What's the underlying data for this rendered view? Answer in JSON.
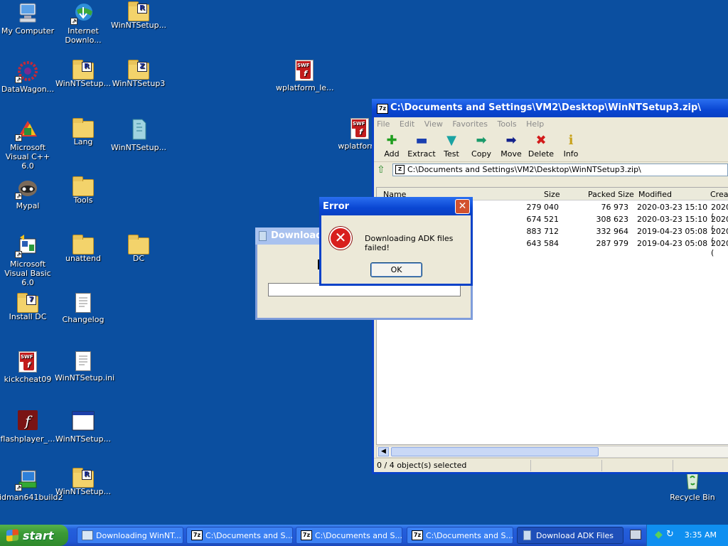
{
  "desktop": {
    "icons": [
      {
        "label": "My Computer"
      },
      {
        "label": "Internet Downlo..."
      },
      {
        "label": "WinNTSetup..."
      },
      {
        "label": "DataWagon..."
      },
      {
        "label": "WinNTSetup..."
      },
      {
        "label": "WinNTSetup3"
      },
      {
        "label": "wplatform_le..."
      },
      {
        "label": "Microsoft Visual C++ 6.0"
      },
      {
        "label": "Lang"
      },
      {
        "label": "WinNTSetup..."
      },
      {
        "label": "wplatform_"
      },
      {
        "label": "Mypal"
      },
      {
        "label": "Tools"
      },
      {
        "label": "Microsoft Visual Basic 6.0"
      },
      {
        "label": "unattend"
      },
      {
        "label": "DC"
      },
      {
        "label": "Install DC"
      },
      {
        "label": "Changelog"
      },
      {
        "label": "kickcheat09"
      },
      {
        "label": "WinNTSetup.ini"
      },
      {
        "label": "flashplayer_..."
      },
      {
        "label": "WinNTSetup..."
      },
      {
        "label": "idman641build2"
      },
      {
        "label": "WinNTSetup..."
      },
      {
        "label": "Recycle Bin"
      }
    ]
  },
  "zip_window": {
    "title": "C:\\Documents and Settings\\VM2\\Desktop\\WinNTSetup3.zip\\",
    "menu": [
      "File",
      "Edit",
      "View",
      "Favorites",
      "Tools",
      "Help"
    ],
    "toolbar": [
      {
        "label": "Add",
        "icon": "plus-icon",
        "color": "#1f9e1f"
      },
      {
        "label": "Extract",
        "icon": "minus-icon",
        "color": "#1a3fb0"
      },
      {
        "label": "Test",
        "icon": "check-arrow-icon",
        "color": "#1aa3a3"
      },
      {
        "label": "Copy",
        "icon": "copy-arrow-icon",
        "color": "#1a9a6a"
      },
      {
        "label": "Move",
        "icon": "move-arrow-icon",
        "color": "#14228c"
      },
      {
        "label": "Delete",
        "icon": "delete-x-icon",
        "color": "#d21a1a"
      },
      {
        "label": "Info",
        "icon": "info-icon",
        "color": "#c9a21a"
      }
    ],
    "address": "C:\\Documents and Settings\\VM2\\Desktop\\WinNTSetup3.zip\\",
    "columns": [
      "Name",
      "Size",
      "Packed Size",
      "Modified",
      "Creat"
    ],
    "rows": [
      {
        "size": "279 040",
        "packed": "76 973",
        "modified": "2020-03-23 15:10",
        "created": "2020-("
      },
      {
        "size": "674 521",
        "packed": "308 623",
        "modified": "2020-03-23 15:10",
        "created": "2020-("
      },
      {
        "size": "883 712",
        "packed": "332 964",
        "modified": "2019-04-23 05:08",
        "created": "2020-("
      },
      {
        "size": "643 584",
        "packed": "287 979",
        "modified": "2019-04-23 05:08",
        "created": "2020-("
      }
    ],
    "status": "0 / 4 object(s) selected"
  },
  "download_window": {
    "title": "Download"
  },
  "error_dialog": {
    "title": "Error",
    "message": "Downloading ADK files failed!",
    "ok_label": "OK",
    "close_glyph": "✕"
  },
  "taskbar": {
    "start_label": "start",
    "tasks": [
      {
        "label": "Downloading WinNT..."
      },
      {
        "label": "C:\\Documents and S..."
      },
      {
        "label": "C:\\Documents and S..."
      },
      {
        "label": "C:\\Documents and S..."
      },
      {
        "label": "Download ADK Files"
      }
    ],
    "time": "3:35 AM"
  }
}
